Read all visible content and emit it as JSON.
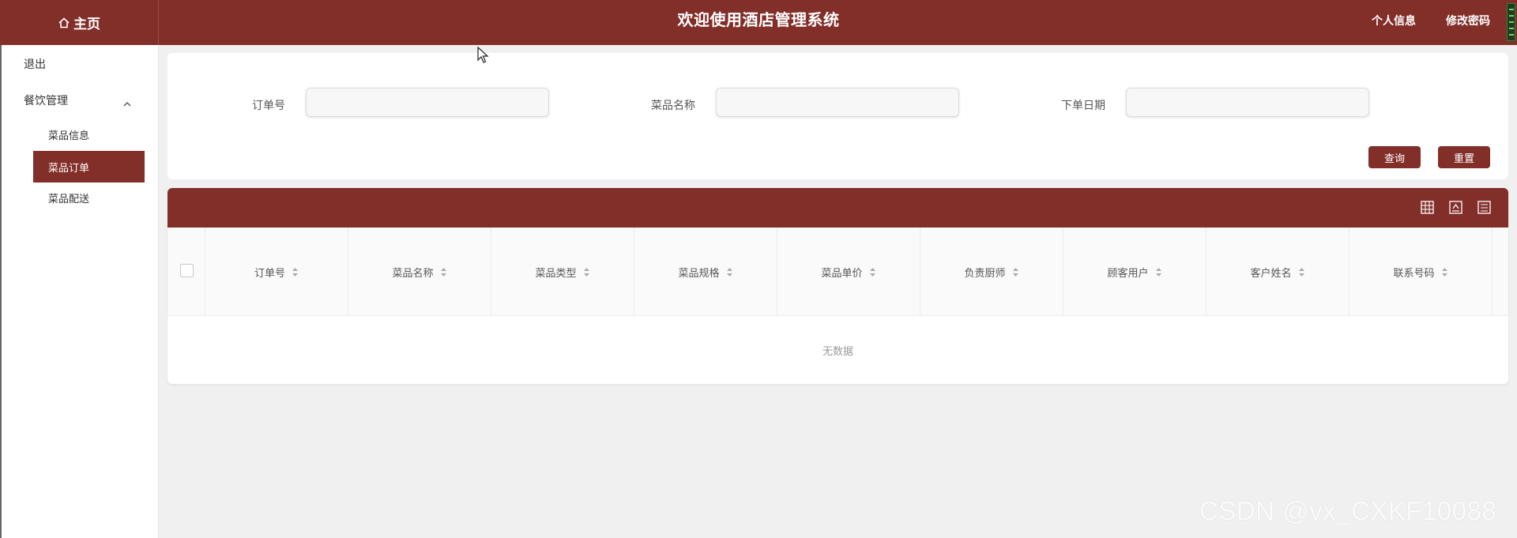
{
  "header": {
    "home_label": "主页",
    "title": "欢迎使用酒店管理系统",
    "links": [
      "个人信息",
      "修改密码"
    ]
  },
  "sidebar": {
    "logout": "退出",
    "group": "餐饮管理",
    "items": [
      {
        "label": "菜品信息",
        "active": false
      },
      {
        "label": "菜品订单",
        "active": true
      },
      {
        "label": "菜品配送",
        "active": false
      }
    ]
  },
  "search": {
    "fields": [
      {
        "label": "订单号",
        "value": ""
      },
      {
        "label": "菜品名称",
        "value": ""
      },
      {
        "label": "下单日期",
        "value": ""
      }
    ],
    "query_button": "查询",
    "reset_button": "重置"
  },
  "table": {
    "columns": [
      "订单号",
      "菜品名称",
      "菜品类型",
      "菜品规格",
      "菜品单价",
      "负责厨师",
      "顾客用户",
      "客户姓名",
      "联系号码"
    ],
    "empty_text": "无数据"
  },
  "watermark": "CSDN @vx_CXKF10088",
  "colors": {
    "brand": "#822e29",
    "page_bg": "#f0f0f0"
  }
}
